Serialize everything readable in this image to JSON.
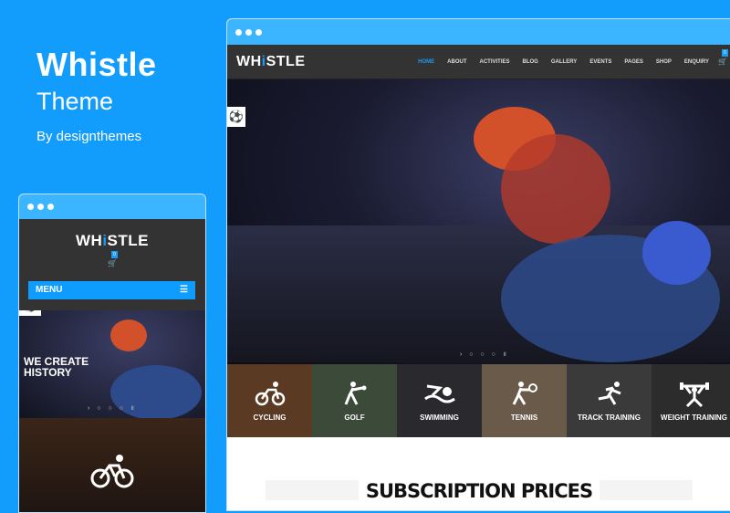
{
  "brand": {
    "title": "Whistle",
    "subtitle": "Theme",
    "byline": "By designthemes"
  },
  "desktop": {
    "logo": {
      "pre": "WH",
      "i": "i",
      "post": "STLE"
    },
    "menu": [
      "HOME",
      "ABOUT",
      "ACTIVITIES",
      "BLOG",
      "GALLERY",
      "EVENTS",
      "PAGES",
      "SHOP",
      "ENQUIRY"
    ],
    "active_menu": "HOME",
    "cart_count": "0",
    "activities": [
      {
        "label": "CYCLING",
        "icon": "cycling-icon"
      },
      {
        "label": "GOLF",
        "icon": "golf-icon"
      },
      {
        "label": "SWIMMING",
        "icon": "swimming-icon"
      },
      {
        "label": "TENNIS",
        "icon": "tennis-icon"
      },
      {
        "label": "TRACK TRAINING",
        "icon": "running-icon"
      },
      {
        "label": "WEIGHT TRAINING",
        "icon": "weightlifting-icon"
      }
    ],
    "section_title": "SUBSCRIPTION PRICES"
  },
  "mobile": {
    "logo": {
      "pre": "WH",
      "i": "i",
      "post": "STLE"
    },
    "cart_count": "0",
    "menu_label": "MENU",
    "hero_text": "WE CREATE HISTORY"
  },
  "colors": {
    "background": "#129cfb",
    "accent": "#1a9bf5",
    "header": "#333333"
  }
}
